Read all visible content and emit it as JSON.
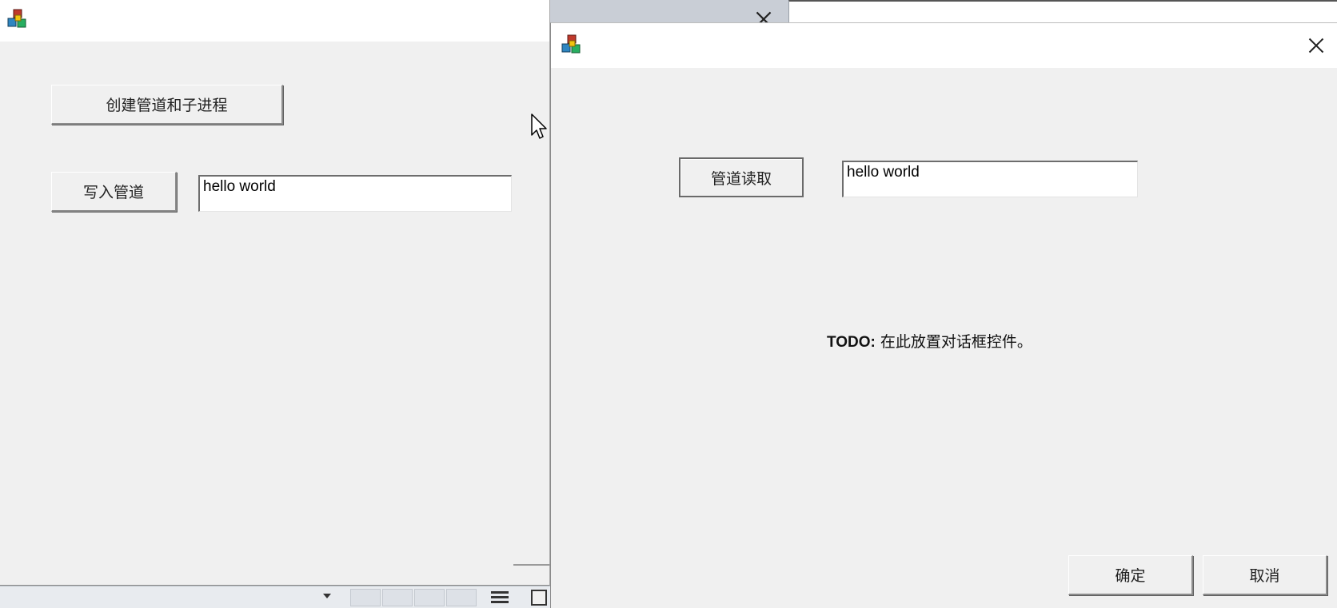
{
  "colors": {
    "window_bg": "#f0f0f0",
    "titlebar_bg": "#ffffff",
    "edit_bg": "#ffffff",
    "text": "#111111"
  },
  "main_window": {
    "icon": "app-blocks-icon",
    "create_button_label": "创建管道和子进程",
    "write_button_label": "写入管道",
    "write_input_value": "hello world"
  },
  "dialog": {
    "icon": "app-blocks-icon",
    "read_button_label": "管道读取",
    "read_input_value": "hello world",
    "todo_bold": "TODO:",
    "todo_text": " 在此放置对话框控件。",
    "ok_button_label": "确定",
    "cancel_button_label": "取消"
  },
  "cursor": {
    "icon": "mouse-pointer-icon"
  }
}
